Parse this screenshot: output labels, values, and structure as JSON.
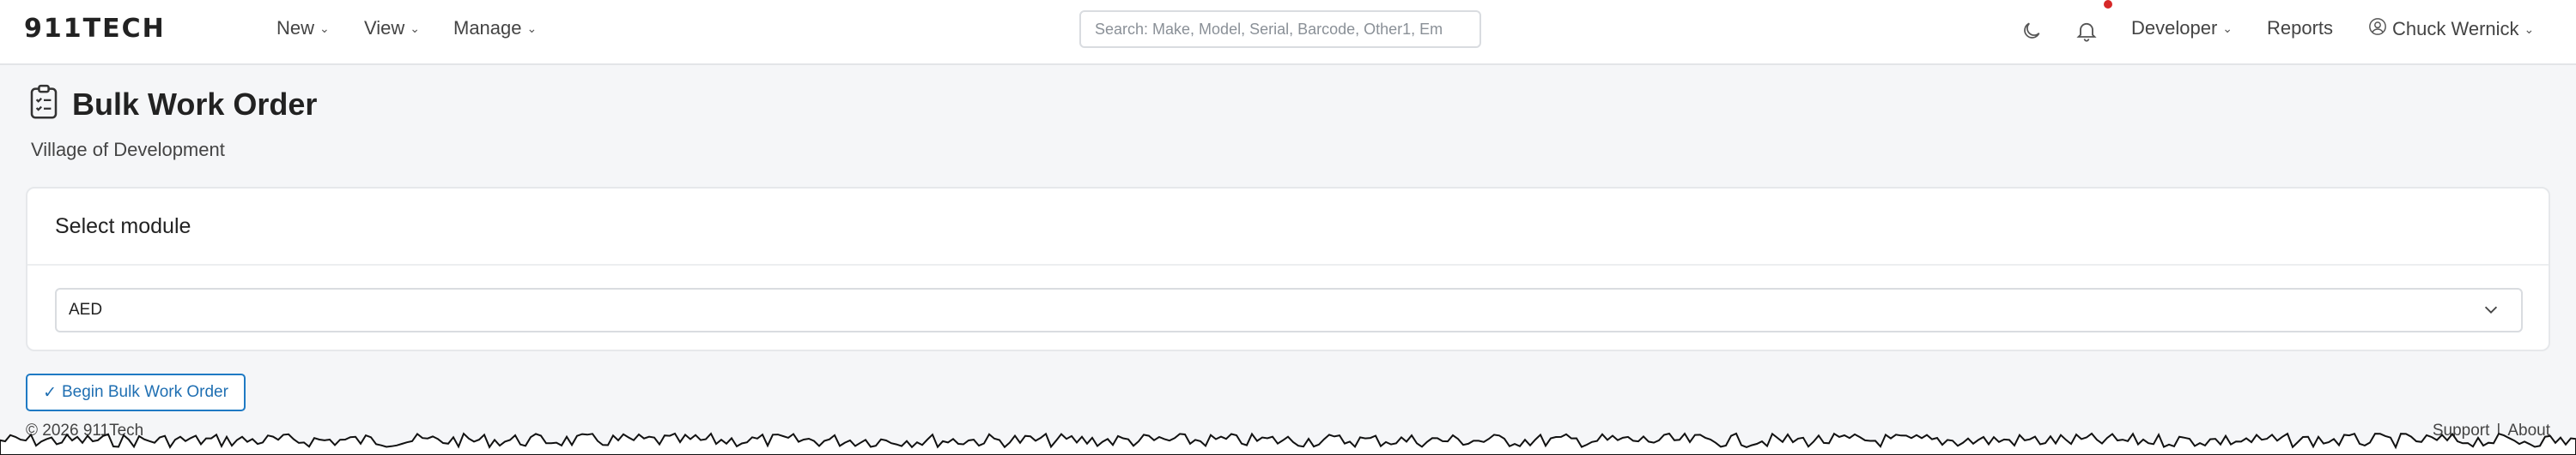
{
  "nav": {
    "brand": "911TECH",
    "menu": [
      {
        "label": "New"
      },
      {
        "label": "View"
      },
      {
        "label": "Manage"
      }
    ],
    "search_placeholder": "Search: Make, Model, Serial, Barcode, Other1, Em",
    "theme_icon": "moon-icon",
    "notification_icon": "bell-icon",
    "notification_dot_color": "#d62828",
    "developer_label": "Developer",
    "reports_label": "Reports",
    "user_label": "Chuck Wernick",
    "user_icon": "user-circle-icon"
  },
  "page": {
    "icon": "clipboard-list-icon",
    "title": "Bulk Work Order",
    "subtitle": "Village of Development"
  },
  "card": {
    "header": "Select module",
    "select_value": "AED"
  },
  "actions": {
    "begin_label": "Begin Bulk Work Order",
    "accent_color": "#1f7ac4"
  },
  "footer": {
    "copyright": "© 2026 911Tech",
    "support_label": "Support",
    "separator": "|",
    "about_label": "About"
  }
}
